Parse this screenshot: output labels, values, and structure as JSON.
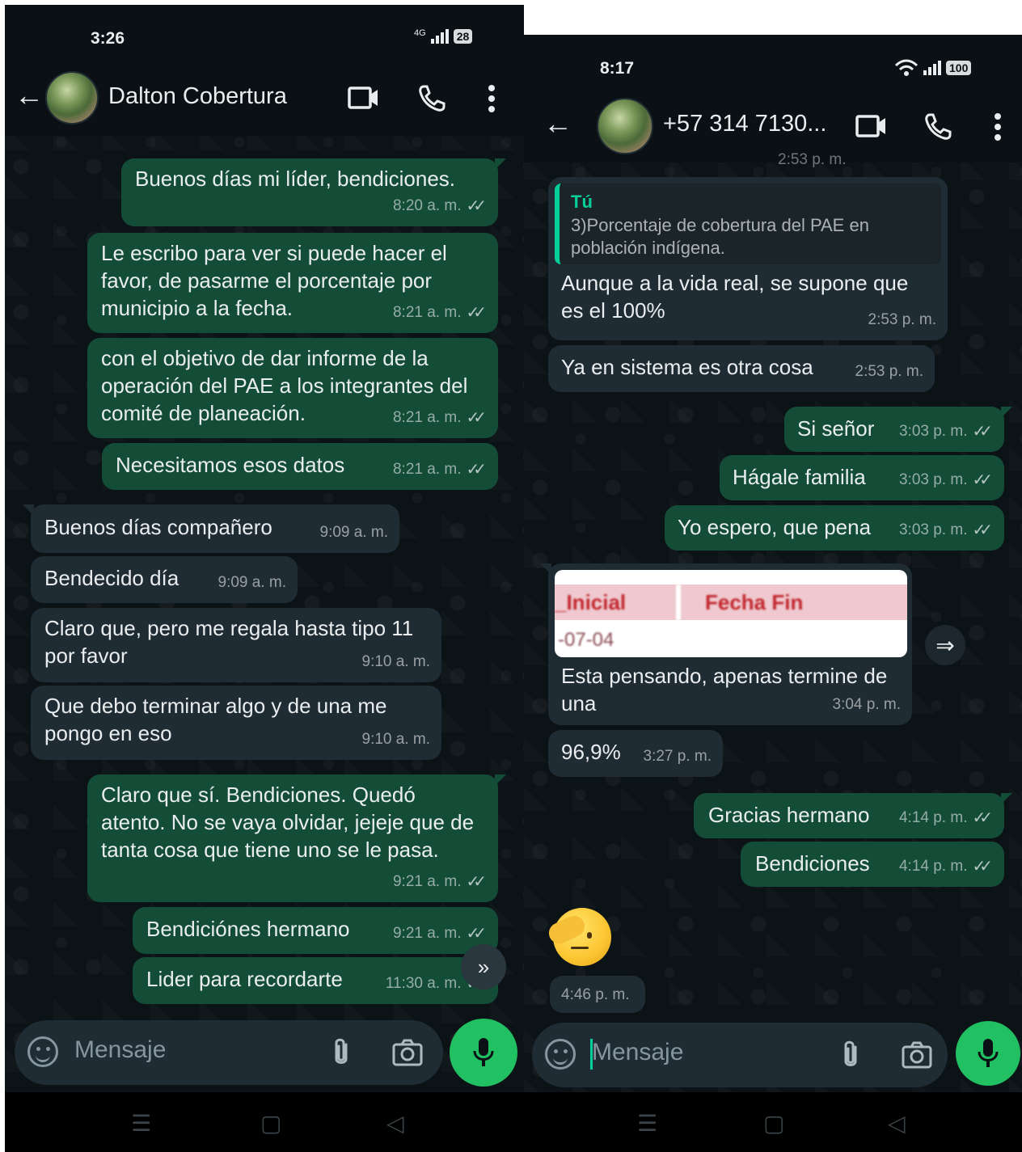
{
  "left": {
    "status": {
      "time": "3:26",
      "network": "4G",
      "battery": "28"
    },
    "header": {
      "contact_name": "Dalton Cobertura"
    },
    "messages": [
      {
        "text": "Buenos días mi líder, bendiciones.",
        "time": "8:20 a. m."
      },
      {
        "text": "Le escribo para ver si puede hacer el favor, de pasarme el porcentaje por municipio a la fecha.",
        "time": "8:21 a. m."
      },
      {
        "text": "con el objetivo de dar informe de la operación del PAE a los integrantes del comité de planeación.",
        "time": "8:21 a. m."
      },
      {
        "text": "Necesitamos esos datos",
        "time": "8:21 a. m."
      },
      {
        "text": "Buenos días compañero",
        "time": "9:09 a. m."
      },
      {
        "text": "Bendecido día",
        "time": "9:09 a. m."
      },
      {
        "text": "Claro que, pero me regala hasta tipo 11 por favor",
        "time": "9:10 a. m."
      },
      {
        "text": "Que debo terminar algo y de una me pongo en eso",
        "time": "9:10 a. m."
      },
      {
        "text": "Claro que sí. Bendiciones. Quedó atento. No se vaya olvidar, jejeje que de tanta cosa que tiene uno se le pasa.",
        "time": "9:21 a. m."
      },
      {
        "text": "Bendiciónes hermano",
        "time": "9:21 a. m."
      },
      {
        "text": "Lider para recordarte",
        "time": "11:30 a. m."
      }
    ],
    "composer": {
      "placeholder": "Mensaje"
    }
  },
  "right": {
    "status": {
      "time": "8:17",
      "battery": "100"
    },
    "header": {
      "contact_name": "+57 314 7130..."
    },
    "partial_time": "2:53 p. m.",
    "reply": {
      "quote_author": "Tú",
      "quote_text": "3)Porcentaje de cobertura del PAE en población indígena.",
      "text": "Aunque a la vida real, se supone que es el 100%",
      "time": "2:53 p. m."
    },
    "messages": [
      {
        "text": "Ya en sistema es otra cosa",
        "time": "2:53 p. m."
      },
      {
        "text": "Si señor",
        "time": "3:03 p. m."
      },
      {
        "text": "Hágale familia",
        "time": "3:03 p. m."
      },
      {
        "text": "Yo espero, que pena",
        "time": "3:03 p. m."
      },
      {
        "text": "96,9%",
        "time": "3:27 p. m."
      },
      {
        "text": "Gracias hermano",
        "time": "4:14 p. m."
      },
      {
        "text": "Bendiciones",
        "time": "4:14 p. m."
      }
    ],
    "image_message": {
      "image_header_1": "_Inicial",
      "image_header_2": "Fecha Fin",
      "image_row": "-07-04",
      "caption": "Esta pensando, apenas termine de una",
      "time": "3:04 p. m."
    },
    "sticker_time": "4:46 p. m.",
    "composer": {
      "placeholder": "Mensaje"
    }
  }
}
